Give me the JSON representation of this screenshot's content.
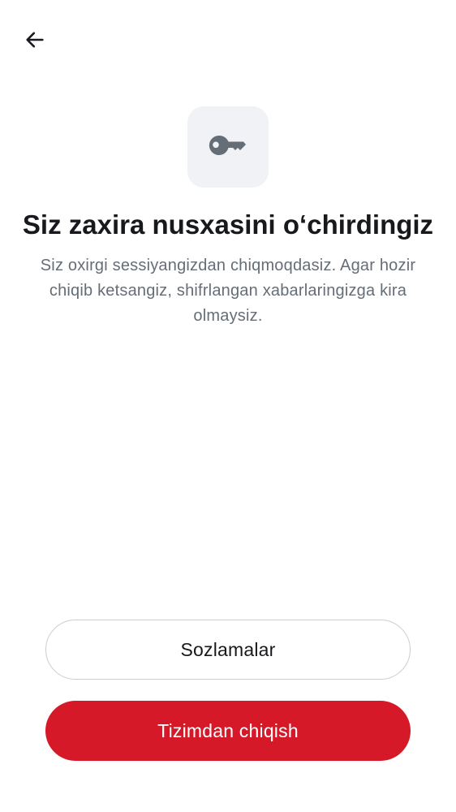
{
  "header": {
    "back_icon": "arrow-left-icon"
  },
  "hero": {
    "icon": "key-icon",
    "icon_color": "#656d77",
    "badge_color": "#f0f2f5"
  },
  "title": "Siz zaxira nusxasini oʻchirdingiz",
  "description": "Siz oxirgi sessiyangizdan chiqmoqdasiz. Agar hozir chiqib ketsangiz, shifrlangan xabarlaringizga kira olmaysiz.",
  "actions": {
    "settings_label": "Sozlamalar",
    "signout_label": "Tizimdan chiqish",
    "signout_color": "#d51928"
  }
}
